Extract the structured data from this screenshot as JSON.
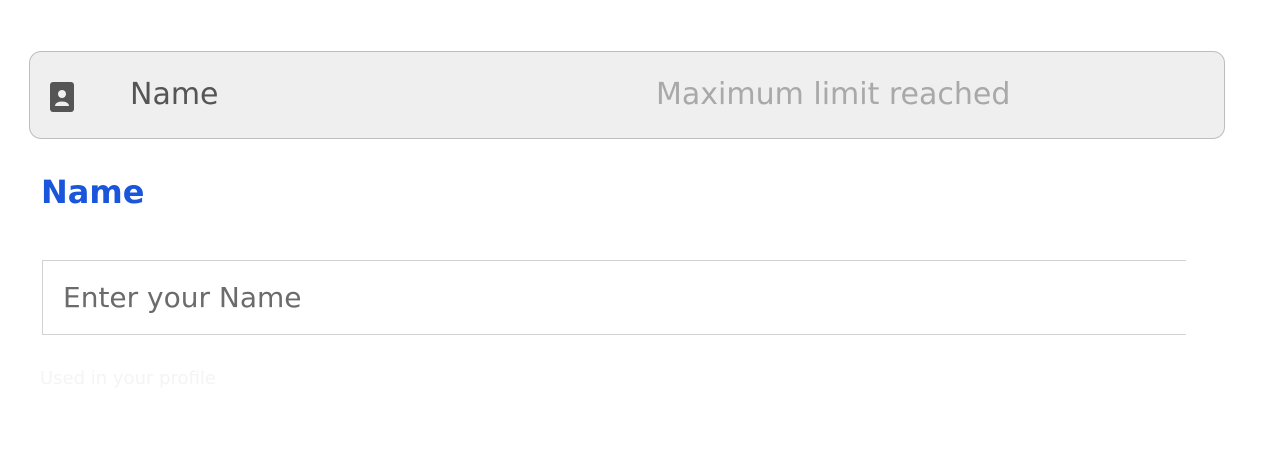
{
  "field_chip": {
    "icon": "contact-card-icon",
    "label": "Name",
    "status": "Maximum limit reached"
  },
  "form": {
    "section_title": "Name",
    "name_input": {
      "value": "",
      "placeholder": "Enter your Name"
    },
    "hint": "Used in your profile"
  },
  "colors": {
    "accent": "#1a56db",
    "chip_background": "#efefef",
    "chip_border": "#bdbdbd",
    "status_text": "#a9a9a9"
  }
}
